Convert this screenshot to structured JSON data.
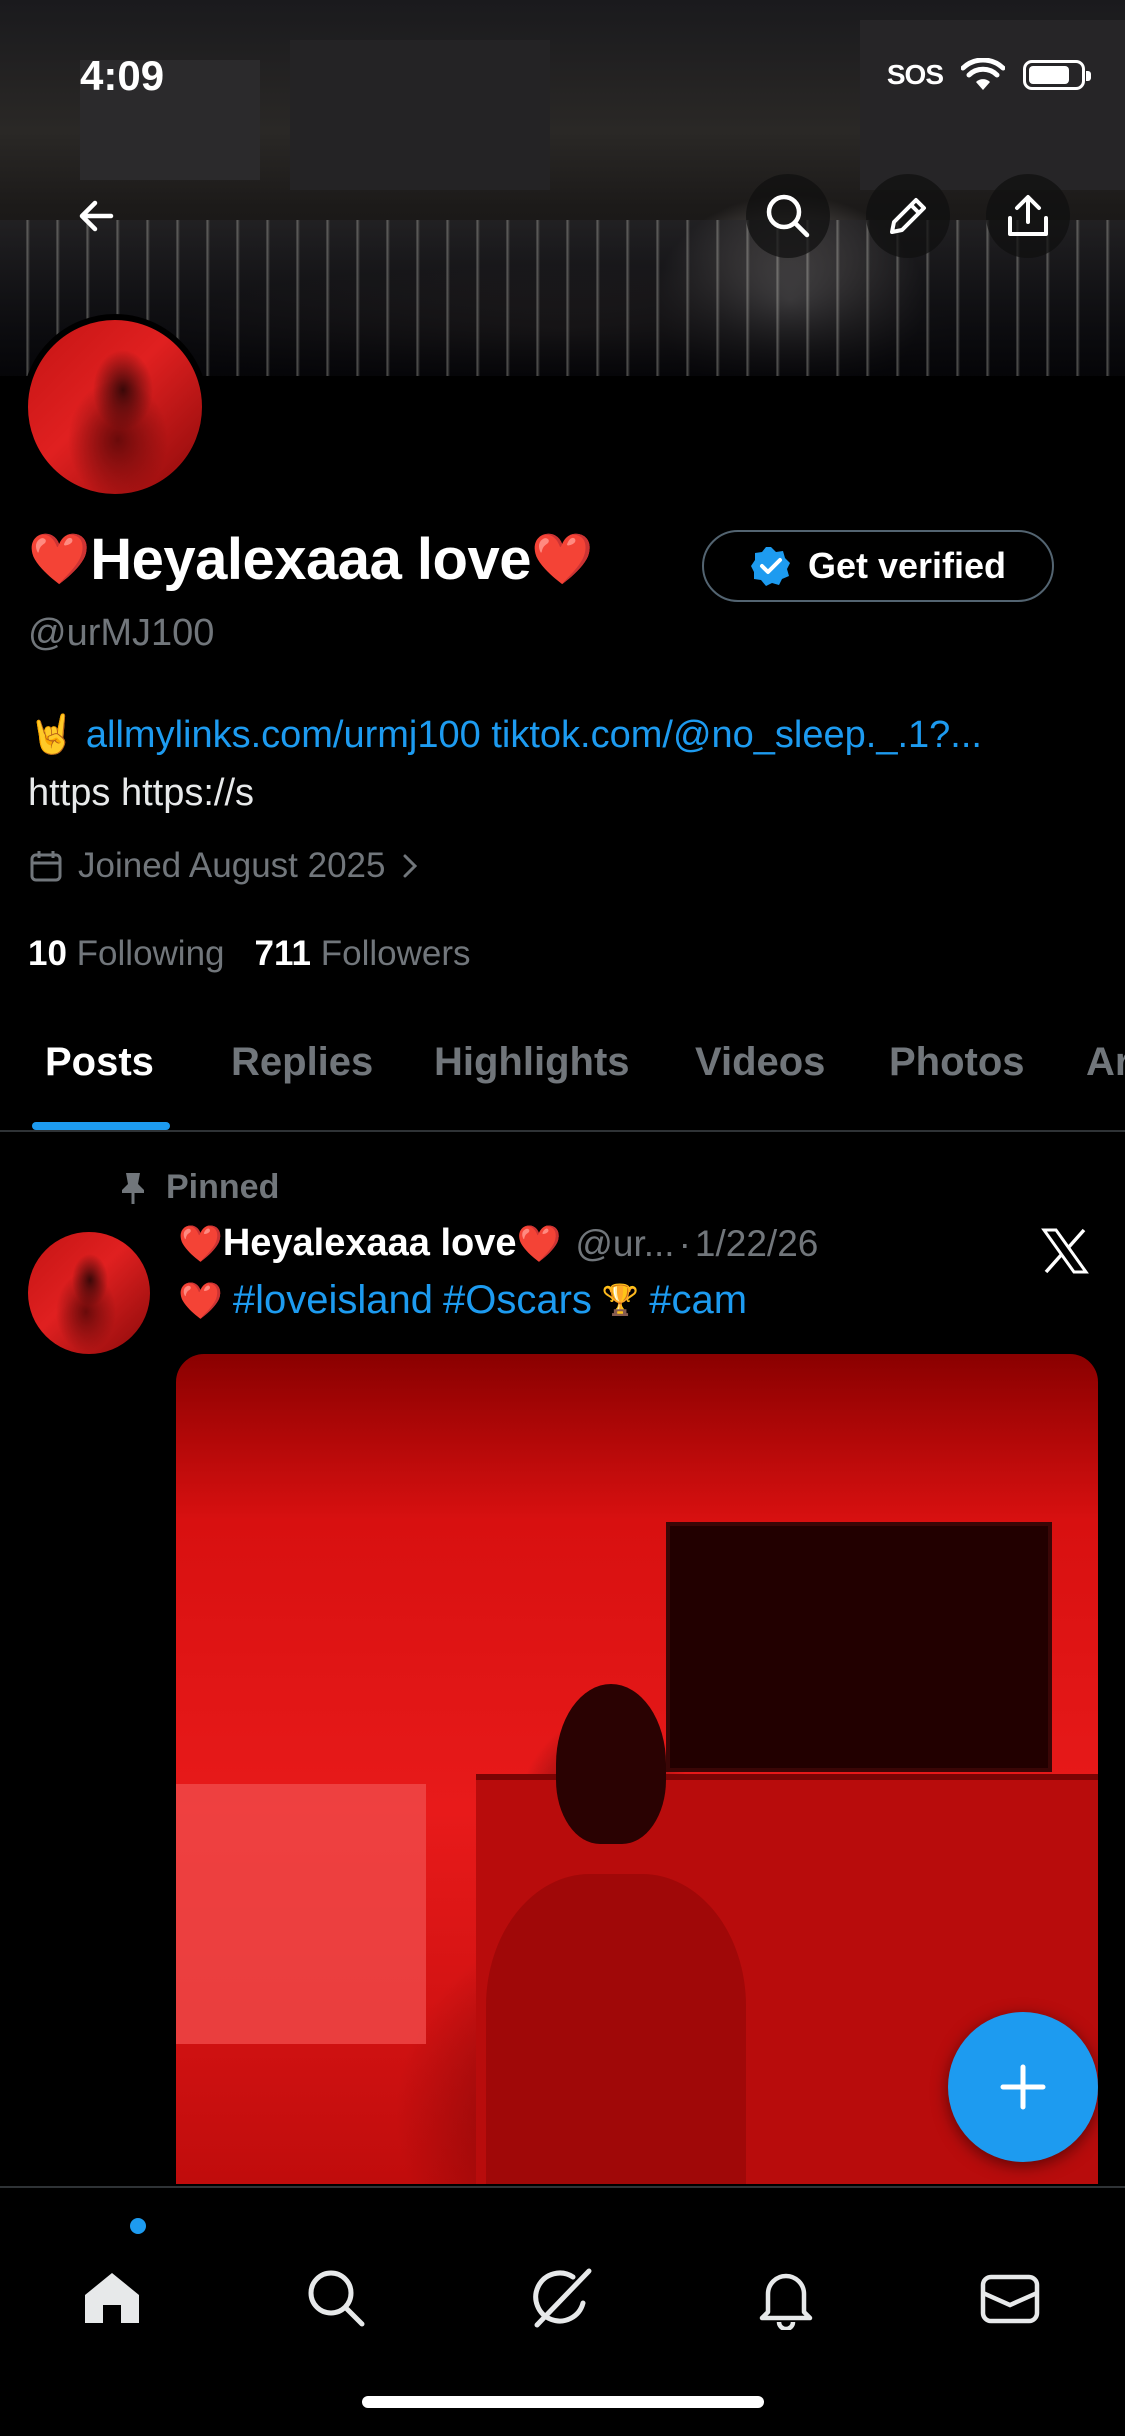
{
  "status_bar": {
    "time": "4:09",
    "sos": "SOS"
  },
  "profile": {
    "display_name": "Heyalexaaa love",
    "name_prefix_emoji": "❤️",
    "name_suffix_emoji": "❤️",
    "handle": "@urMJ100",
    "get_verified_label": "Get verified",
    "bio_emoji": "🤘",
    "bio_link_1": "allmylinks.com/urmj100",
    "bio_link_2": "tiktok.com/@no_sleep._.1?...",
    "bio_line_2": "https https://s",
    "joined": "Joined August 2025",
    "following_count": "10",
    "following_label": "Following",
    "followers_count": "711",
    "followers_label": "Followers"
  },
  "tabs": [
    {
      "label": "Posts",
      "active": true
    },
    {
      "label": "Replies"
    },
    {
      "label": "Highlights"
    },
    {
      "label": "Videos"
    },
    {
      "label": "Photos"
    },
    {
      "label": "Ar"
    }
  ],
  "post": {
    "pinned_label": "Pinned",
    "author_name": "Heyalexaaa love",
    "author_prefix_emoji": "❤️",
    "author_suffix_emoji": "❤️",
    "author_handle": "@ur...",
    "separator": "·",
    "date": "1/22/26",
    "text_heart": "❤️",
    "tag_1": "#loveisland",
    "tag_2": "#Oscars",
    "oscar_emoji": "🏆",
    "tag_3": "#cam"
  },
  "colors": {
    "accent": "#1d9bf0",
    "heart": "#ff2e3b",
    "muted": "#71767b",
    "border": "#2f3336"
  },
  "icons": [
    "back-arrow-icon",
    "search-icon",
    "edit-pencil-icon",
    "share-icon",
    "verified-badge-icon",
    "calendar-icon",
    "chevron-right-icon",
    "pin-icon",
    "x-logo-icon",
    "plus-icon",
    "home-icon",
    "explore-search-icon",
    "grok-icon",
    "bell-icon",
    "mail-icon"
  ]
}
